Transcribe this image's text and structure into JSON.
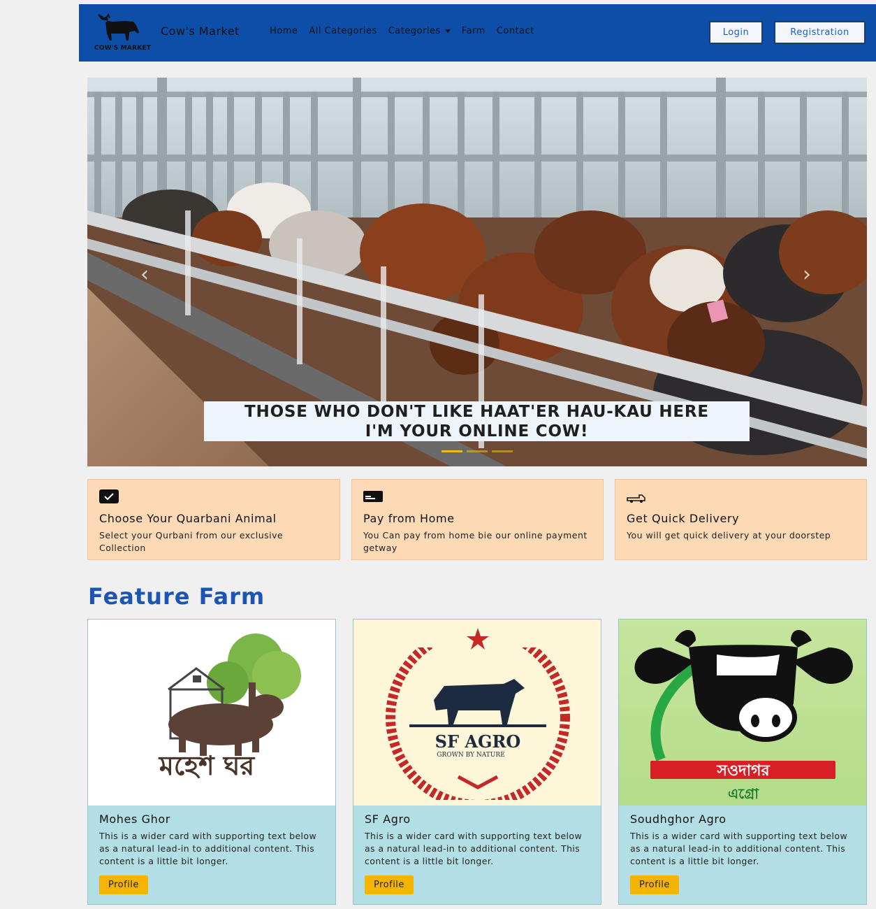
{
  "navbar": {
    "logo_text": "COW'S MARKET",
    "brand": "Cow's Market",
    "links": [
      "Home",
      "All Categories",
      "Categories",
      "Farm",
      "Contact"
    ],
    "login": "Login",
    "registration": "Registration"
  },
  "hero": {
    "caption_line1": "THOSE WHO DON'T LIKE HAAT'ER HAU-KAU HERE",
    "caption_line2": "I'M YOUR ONLINE COW!",
    "slide_count": 3,
    "active_slide": 1,
    "prev_glyph": "‹",
    "next_glyph": "›"
  },
  "features": [
    {
      "icon": "check-square-icon",
      "title": "Choose Your Quarbani Animal",
      "text": "Select your Qurbani from our exclusive Collection"
    },
    {
      "icon": "credit-card-icon",
      "title": "Pay from Home",
      "text": "You Can pay from home bie our online payment getway"
    },
    {
      "icon": "delivery-truck-icon",
      "title": "Get Quick Delivery",
      "text": "You will get quick delivery at your doorstep"
    }
  ],
  "section_title": "Feature Farm",
  "cards": [
    {
      "name": "Mohes Ghor",
      "logo_text": "মহেশ ঘর",
      "text": "This is a wider card with supporting text below as a natural lead-in to additional content. This content is a little bit longer.",
      "button": "Profile"
    },
    {
      "name": "SF Agro",
      "logo_text": "SF AGRO",
      "logo_sub": "GROWN BY NATURE",
      "text": "This is a wider card with supporting text below as a natural lead-in to additional content. This content is a little bit longer.",
      "button": "Profile"
    },
    {
      "name": "Soudhghor Agro",
      "logo_text": "সওদাগর",
      "logo_sub": "এগ্রো",
      "text": "This is a wider card with supporting text below as a natural lead-in to additional content. This content is a little bit longer.",
      "button": "Profile"
    }
  ],
  "colors": {
    "navbar": "#0d4fa8",
    "feature_bg": "#fdd9b5",
    "card_bg": "#b1dfe5",
    "accent_button": "#f4b400",
    "section_title": "#1c55b3"
  }
}
